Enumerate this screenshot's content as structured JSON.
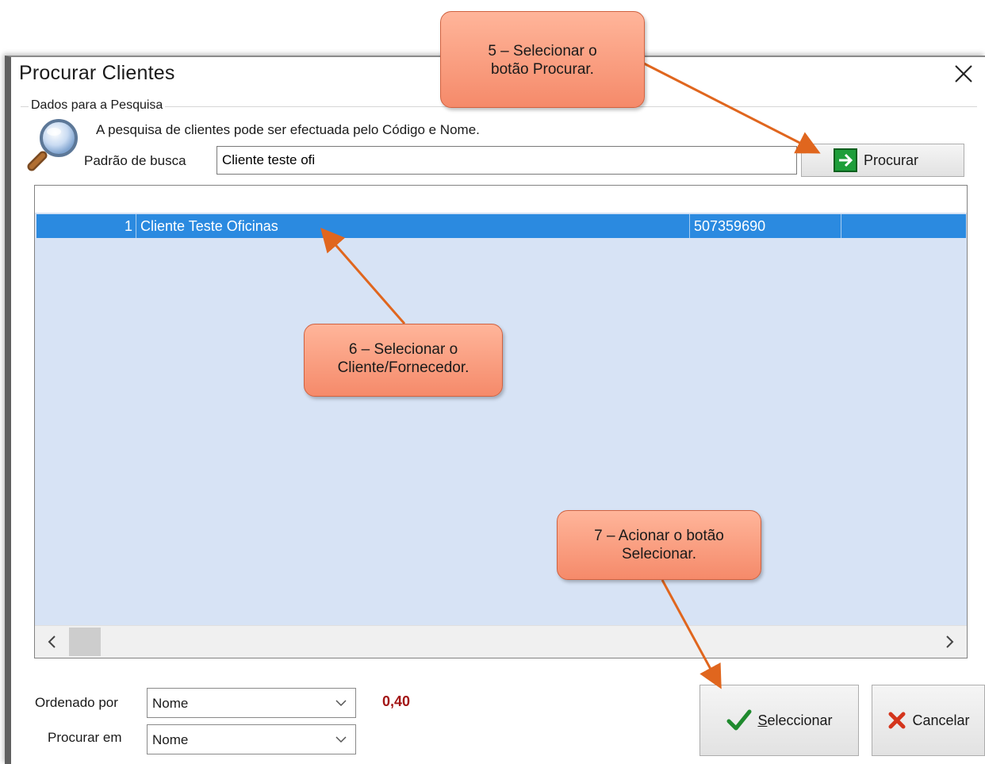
{
  "window": {
    "title": "Procurar Clientes"
  },
  "search_group": {
    "label": "Dados para a Pesquisa",
    "info": "A pesquisa de clientes pode ser efectuada pelo Código e Nome.",
    "pattern_label": "Padrão de busca",
    "pattern_value": "Cliente teste ofi",
    "search_button": "Procurar"
  },
  "results": {
    "rows": [
      {
        "num": "1",
        "name": "Cliente Teste Oficinas",
        "nif": "507359690"
      }
    ]
  },
  "footer": {
    "order_label": "Ordenado por",
    "order_value": "Nome",
    "search_in_label": "Procurar em",
    "search_in_value": "Nome",
    "elapsed": "0,40",
    "select_button_first": "S",
    "select_button_rest": "eleccionar",
    "cancel_button": "Cancelar"
  },
  "callouts": {
    "step5_line1": "5 – Selecionar o",
    "step5_line2": "botão Procurar.",
    "step6_line1": "6 – Selecionar o",
    "step6_line2": "Cliente/Fornecedor.",
    "step7_line1": "7 – Acionar o botão",
    "step7_line2": "Selecionar."
  },
  "colors": {
    "selection": "#2b8ae0",
    "grid_background": "#d7e3f5",
    "callout": "#f58a6a",
    "arrow": "#e0661e",
    "elapsed_text": "#a31616"
  }
}
